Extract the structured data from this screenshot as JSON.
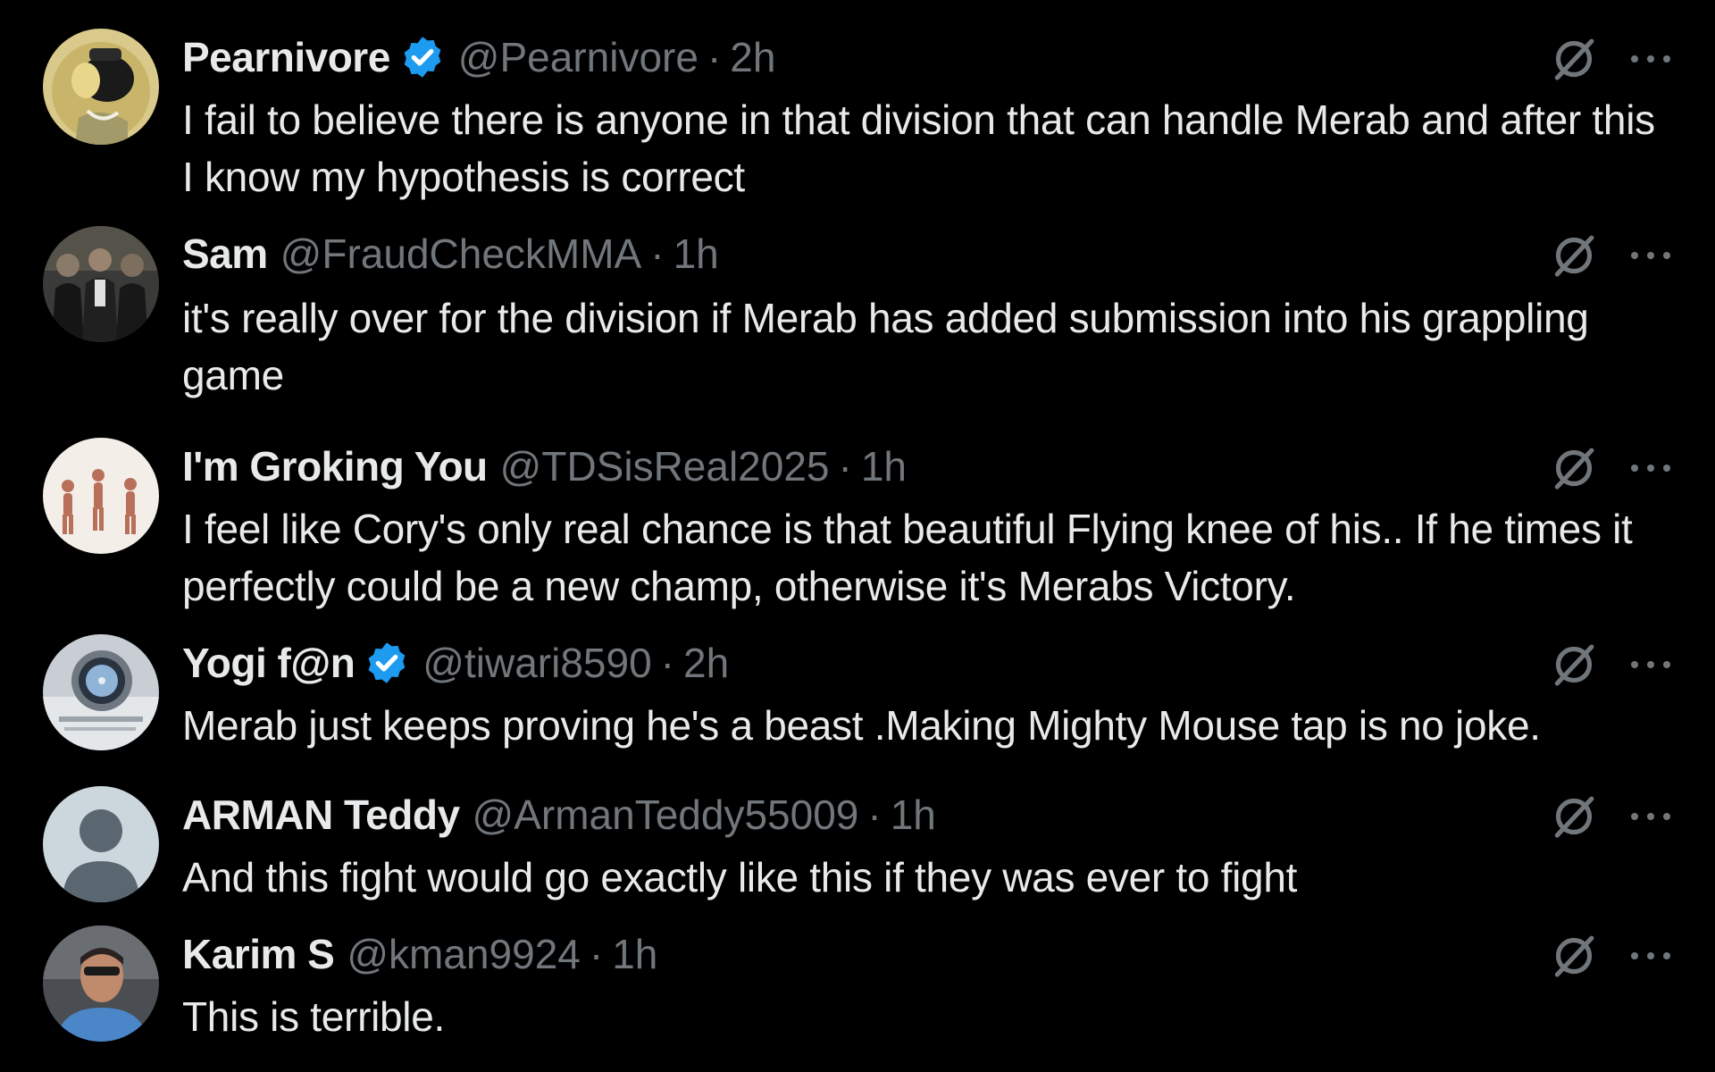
{
  "colors": {
    "background": "#000000",
    "text": "#e7e9ea",
    "muted": "#71767b",
    "verified": "#1d9bf0"
  },
  "replies": [
    {
      "name": "Pearnivore",
      "verified": true,
      "handle": "@Pearnivore",
      "separator": "·",
      "time": "2h",
      "text": "I fail to believe there is anyone in that division that can handle Merab and after this I know my hypothesis is correct",
      "avatar": "cartoon-character-avatar"
    },
    {
      "name": "Sam",
      "verified": false,
      "handle": "@FraudCheckMMA",
      "separator": "·",
      "time": "1h",
      "text": "it's really over for the division if Merab has added submission into his grappling game",
      "avatar": "group-photo-avatar"
    },
    {
      "name": "I'm Groking You",
      "verified": false,
      "handle": "@TDSisReal2025",
      "separator": "·",
      "time": "1h",
      "text": "I feel like Cory's only real chance is that beautiful Flying knee of his.. If he times it perfectly could be a new champ, otherwise it's Merabs Victory.",
      "avatar": "evolution-illustration-avatar"
    },
    {
      "name": "Yogi f@n",
      "verified": true,
      "handle": "@tiwari8590",
      "separator": "·",
      "time": "2h",
      "text": "Merab just keeps proving he's a beast .Making Mighty Mouse tap is no joke.",
      "avatar": "watch-photo-avatar"
    },
    {
      "name": "ARMAN Teddy",
      "verified": false,
      "handle": "@ArmanTeddy55009",
      "separator": "·",
      "time": "1h",
      "text": "And this fight  would go exactly like this if they was ever to fight",
      "avatar": "default-profile-avatar"
    },
    {
      "name": "Karim S",
      "verified": false,
      "handle": "@kman9924",
      "separator": "·",
      "time": "1h",
      "text": "This is terrible.",
      "avatar": "selfie-photo-avatar"
    }
  ],
  "icons": {
    "grok": "grok-icon",
    "more": "more-options-icon",
    "verified": "verified-badge-icon"
  }
}
